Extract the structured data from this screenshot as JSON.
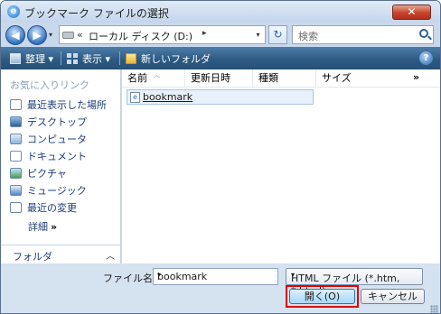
{
  "window": {
    "title": "ブックマーク ファイルの選択",
    "close_glyph": "✕"
  },
  "nav": {
    "back_glyph": "◀",
    "forward_glyph": "▶",
    "address_chevron": "«",
    "address_text": "ローカル ディスク (D:)",
    "address_arrow": "▸",
    "refresh_glyph": "↻",
    "search_placeholder": "検索"
  },
  "toolbar": {
    "organize": "整理 ▾",
    "views": "表示 ▾",
    "new_folder": "新しいフォルダ",
    "help_glyph": "?"
  },
  "sidebar": {
    "title": "お気に入りリンク",
    "items": [
      {
        "label": "最近表示した場所",
        "icon": "recent-places-icon"
      },
      {
        "label": "デスクトップ",
        "icon": "desktop-icon"
      },
      {
        "label": "コンピュータ",
        "icon": "computer-icon"
      },
      {
        "label": "ドキュメント",
        "icon": "documents-icon"
      },
      {
        "label": "ピクチャ",
        "icon": "pictures-icon"
      },
      {
        "label": "ミュージック",
        "icon": "music-icon"
      },
      {
        "label": "最近の変更",
        "icon": "recently-changed-icon"
      }
    ],
    "more": "詳細",
    "more_glyph": "»",
    "folders": "フォルダ",
    "folders_glyph": "︿"
  },
  "filelist": {
    "columns": [
      "名前",
      "更新日時",
      "種類",
      "サイズ"
    ],
    "more_glyph": "»",
    "files": [
      {
        "name": "bookmark",
        "icon": "html-file-icon"
      }
    ]
  },
  "footer": {
    "filename_label": "ファイル名(N):",
    "filename_value": "bookmark",
    "filter_value": "HTML ファイル (*.htm, *.html)",
    "open_label": "開く(O)",
    "cancel_label": "キャンセル"
  }
}
